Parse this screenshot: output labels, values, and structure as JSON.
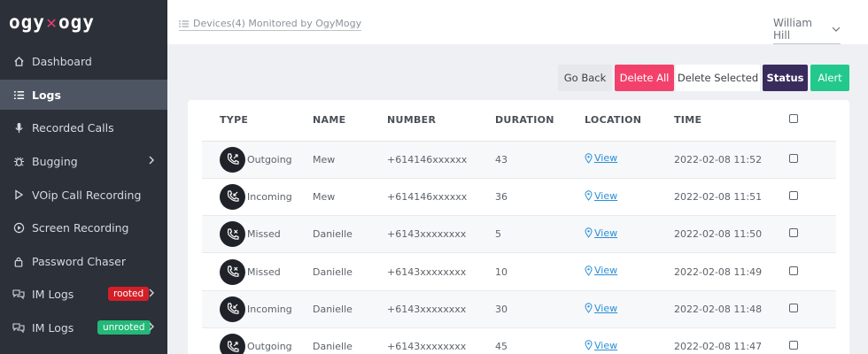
{
  "brand": {
    "left": "ogy",
    "right": "ogy",
    "accent": "#e53d6f"
  },
  "sidebar": {
    "items": [
      {
        "label": "Dashboard",
        "icon": "home-icon"
      },
      {
        "label": "Logs",
        "icon": "list-icon",
        "active": true
      },
      {
        "label": "Recorded Calls",
        "icon": "microphone-icon"
      },
      {
        "label": "Bugging",
        "icon": "bug-icon"
      },
      {
        "label": "VOip Call Recording",
        "icon": "play-icon"
      },
      {
        "label": "Screen Recording",
        "icon": "record-icon"
      },
      {
        "label": "Password Chaser",
        "icon": "lock-icon"
      },
      {
        "label": "IM Logs",
        "icon": "chat-icon",
        "badge": "rooted"
      },
      {
        "label": "IM Logs",
        "icon": "chat-icon",
        "badge": "unrooted"
      }
    ]
  },
  "header": {
    "breadcrumb": "Devices(4) Monitored by OgyMogy",
    "user": "William Hill"
  },
  "actions": {
    "go_back": "Go Back",
    "delete_all": "Delete All",
    "delete_selected": "Delete Selected",
    "status": "Status",
    "alert": "Alert"
  },
  "table": {
    "headers": [
      "TYPE",
      "NAME",
      "NUMBER",
      "DURATION",
      "LOCATION",
      "TIME"
    ],
    "rows": [
      {
        "type": "Outgoing",
        "name": "Mew",
        "number": "+614146xxxxxx",
        "duration": "43",
        "location": "View",
        "time": "2022-02-08 11:52"
      },
      {
        "type": "Incoming",
        "name": "Mew",
        "number": "+614146xxxxxx",
        "duration": "36",
        "location": "View",
        "time": "2022-02-08 11:51"
      },
      {
        "type": "Missed",
        "name": "Danielle",
        "number": "+6143xxxxxxxx",
        "duration": "5",
        "location": "View",
        "time": "2022-02-08 11:50"
      },
      {
        "type": "Missed",
        "name": "Danielle",
        "number": "+6143xxxxxxxx",
        "duration": "10",
        "location": "View",
        "time": "2022-02-08 11:49"
      },
      {
        "type": "Incoming",
        "name": "Danielle",
        "number": "+6143xxxxxxxx",
        "duration": "30",
        "location": "View",
        "time": "2022-02-08 11:48"
      },
      {
        "type": "Outgoing",
        "name": "Danielle",
        "number": "+6143xxxxxxxx",
        "duration": "45",
        "location": "View",
        "time": "2022-02-08 11:47"
      }
    ]
  }
}
